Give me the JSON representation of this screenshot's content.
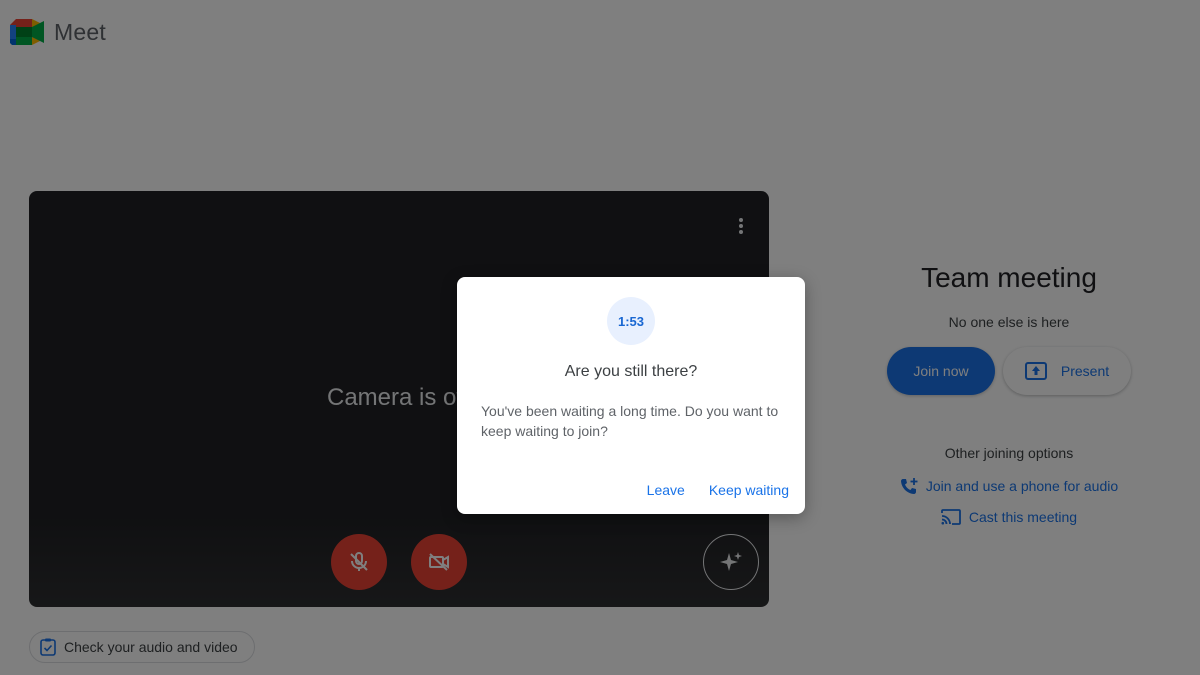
{
  "app": {
    "title": "Meet"
  },
  "preview": {
    "camera_status": "Camera is off",
    "controls": {
      "mic": "microphone-off-icon",
      "camera": "camera-off-icon",
      "effects": "sparkle-effects-icon"
    }
  },
  "check_av": {
    "label": "Check your audio and video"
  },
  "meeting": {
    "title": "Team meeting",
    "status": "No one else is here",
    "join_label": "Join now",
    "present_label": "Present",
    "other_options_label": "Other joining options",
    "phone_audio_label": "Join and use a phone for audio",
    "cast_label": "Cast this meeting"
  },
  "dialog": {
    "timer": "1:53",
    "title": "Are you still there?",
    "body": "You've been waiting a long time. Do you want to keep waiting to join?",
    "leave_label": "Leave",
    "keep_waiting_label": "Keep waiting"
  },
  "colors": {
    "accent": "#1a73e8",
    "danger": "#ea4335",
    "preview_bg": "#202124",
    "overlay": "rgba(0,0,0,0.5)"
  }
}
